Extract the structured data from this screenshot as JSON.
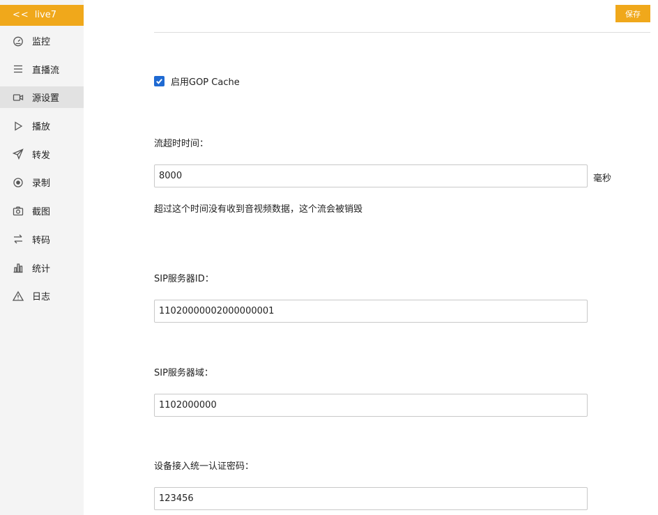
{
  "sidebar": {
    "header": {
      "chevron": "<<",
      "title": "live7"
    },
    "items": [
      {
        "label": "监控",
        "icon": "dashboard-icon"
      },
      {
        "label": "直播流",
        "icon": "list-icon"
      },
      {
        "label": "源设置",
        "icon": "video-camera-icon",
        "active": true
      },
      {
        "label": "播放",
        "icon": "play-icon"
      },
      {
        "label": "转发",
        "icon": "send-icon"
      },
      {
        "label": "录制",
        "icon": "record-icon"
      },
      {
        "label": "截图",
        "icon": "camera-icon"
      },
      {
        "label": "转码",
        "icon": "swap-icon"
      },
      {
        "label": "统计",
        "icon": "bar-chart-icon"
      },
      {
        "label": "日志",
        "icon": "warning-icon"
      }
    ]
  },
  "toolbar": {
    "save_label": "保存"
  },
  "form": {
    "gop_cache": {
      "label": "启用GOP Cache",
      "checked": true
    },
    "stream_timeout": {
      "label": "流超时时间：",
      "value": "8000",
      "unit": "毫秒",
      "hint": "超过这个时间没有收到音视频数据，这个流会被销毁"
    },
    "sip_server_id": {
      "label": "SIP服务器ID：",
      "value": "11020000002000000001"
    },
    "sip_server_domain": {
      "label": "SIP服务器域：",
      "value": "1102000000"
    },
    "auth_password": {
      "label": "设备接入统一认证密码：",
      "value": "123456"
    }
  },
  "colors": {
    "accent": "#f0a81b",
    "checkbox": "#1f6ad2",
    "sidebar_bg": "#f4f4f4",
    "active_bg": "#e2e2e2"
  }
}
